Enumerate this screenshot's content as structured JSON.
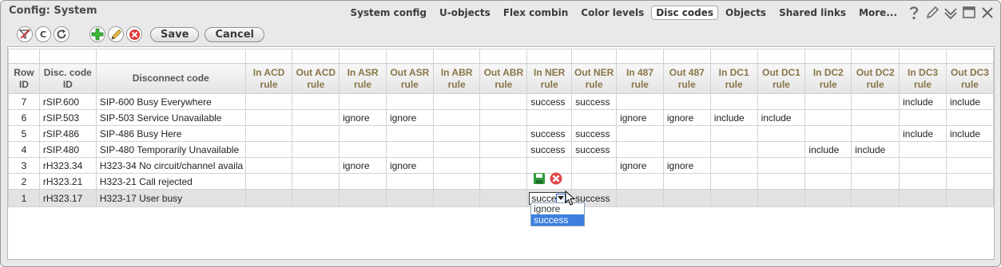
{
  "window": {
    "title": "Config: System"
  },
  "nav": {
    "tabs": [
      {
        "label": "System config",
        "active": false
      },
      {
        "label": "U-objects",
        "active": false
      },
      {
        "label": "Flex combin",
        "active": false
      },
      {
        "label": "Color levels",
        "active": false
      },
      {
        "label": "Disc codes",
        "active": true
      },
      {
        "label": "Objects",
        "active": false
      },
      {
        "label": "Shared links",
        "active": false
      },
      {
        "label": "More...",
        "active": false
      }
    ],
    "icons": [
      "help-icon",
      "edit-pen-icon",
      "collapse-icon",
      "maximize-icon",
      "close-icon"
    ]
  },
  "toolbar": {
    "save_label": "Save",
    "cancel_label": "Cancel",
    "icons": [
      "clear-filter-icon",
      "c-icon",
      "refresh-icon",
      "add-icon",
      "edit-icon",
      "delete-icon"
    ],
    "c_glyph": "C"
  },
  "table": {
    "headers": {
      "row_id": "Row ID",
      "disc_code_id": "Disc. code ID",
      "disconnect_code": "Disconnect code",
      "rules": [
        "In ACD rule",
        "Out ACD rule",
        "In ASR rule",
        "Out ASR rule",
        "In ABR rule",
        "Out ABR rule",
        "In NER rule",
        "Out NER rule",
        "In 487 rule",
        "Out 487 rule",
        "In DC1 rule",
        "Out DC1 rule",
        "In DC2 rule",
        "Out DC2 rule",
        "In DC3 rule",
        "Out DC3 rule"
      ]
    },
    "rows": [
      {
        "row_id": "7",
        "code_id": "rSIP.600",
        "name": "SIP-600 Busy Everywhere",
        "rules": [
          "",
          "",
          "",
          "",
          "",
          "",
          "success",
          "success",
          "",
          "",
          "",
          "",
          "",
          "",
          "include",
          "include"
        ]
      },
      {
        "row_id": "6",
        "code_id": "rSIP.503",
        "name": "SIP-503 Service Unavailable",
        "rules": [
          "",
          "",
          "ignore",
          "ignore",
          "",
          "",
          "",
          "",
          "ignore",
          "ignore",
          "include",
          "include",
          "",
          "",
          "",
          ""
        ]
      },
      {
        "row_id": "5",
        "code_id": "rSIP.486",
        "name": "SIP-486 Busy Here",
        "rules": [
          "",
          "",
          "",
          "",
          "",
          "",
          "success",
          "success",
          "",
          "",
          "",
          "",
          "",
          "",
          "include",
          "include"
        ]
      },
      {
        "row_id": "4",
        "code_id": "rSIP.480",
        "name": "SIP-480 Temporarily Unavailable",
        "rules": [
          "",
          "",
          "",
          "",
          "",
          "",
          "success",
          "success",
          "",
          "",
          "",
          "",
          "include",
          "include",
          "",
          ""
        ]
      },
      {
        "row_id": "3",
        "code_id": "rH323.34",
        "name": "H323-34 No circuit/channel availa",
        "rules": [
          "",
          "",
          "ignore",
          "ignore",
          "",
          "",
          "",
          "",
          "ignore",
          "ignore",
          "",
          "",
          "",
          "",
          "",
          ""
        ]
      },
      {
        "row_id": "2",
        "code_id": "rH323.21",
        "name": "H323-21 Call rejected",
        "rules": [
          "",
          "",
          "",
          "",
          "",
          "",
          "",
          "",
          "",
          "",
          "",
          "",
          "",
          "",
          "",
          ""
        ]
      },
      {
        "row_id": "1",
        "code_id": "rH323.17",
        "name": "H323-17 User busy",
        "rules": [
          "",
          "",
          "",
          "",
          "",
          "",
          "",
          "success",
          "",
          "",
          "",
          "",
          "",
          "",
          "",
          ""
        ]
      }
    ]
  },
  "editor": {
    "combo_value": "succe",
    "options": [
      "ignore",
      "success"
    ],
    "highlighted": "success"
  }
}
